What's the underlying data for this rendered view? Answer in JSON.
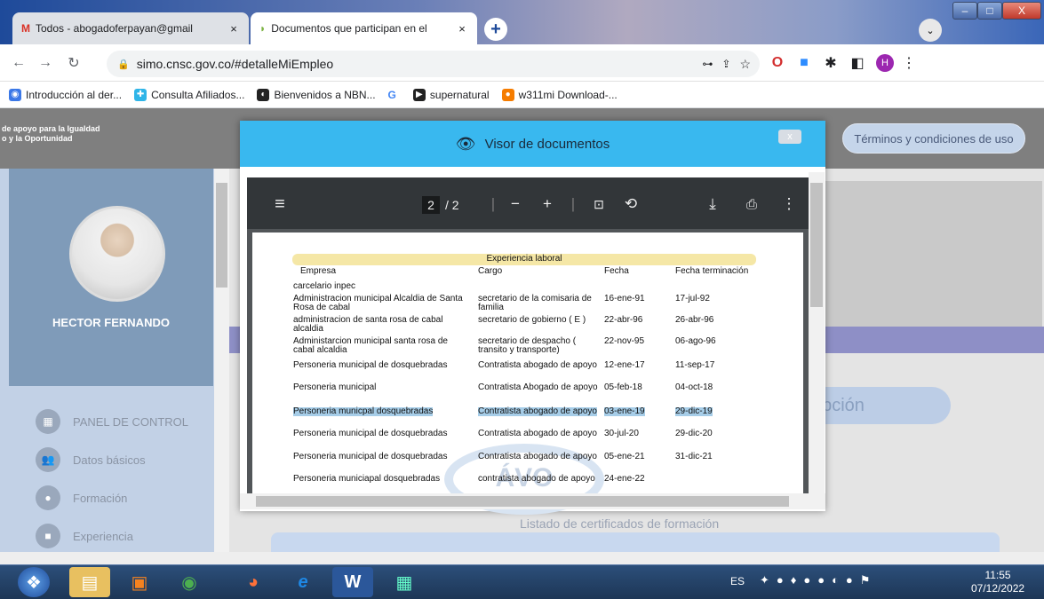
{
  "browser": {
    "tabs": [
      {
        "label": "Todos - abogadoferpayan@gmail",
        "close": "×"
      },
      {
        "label": "Documentos que participan en el",
        "close": "×"
      }
    ],
    "new_tab": "+",
    "url": "simo.cnsc.gov.co/#detalleMiEmpleo",
    "profile_initial": "H",
    "bookmarks": [
      "Introducción al der...",
      "Consulta Afiliados...",
      "Bienvenidos a NBN...",
      "",
      "supernatural",
      "w311mi Download-..."
    ]
  },
  "page": {
    "org_line1": "de apoyo para la Igualdad",
    "org_line2": "o y la Oportunidad",
    "terms_button": "Términos y condiciones de uso",
    "user_name": "HECTOR FERNANDO",
    "nav": [
      "PANEL DE CONTROL",
      "Datos básicos",
      "Formación",
      "Experiencia"
    ],
    "inscription_partial": "ripción",
    "listado": "Listado de certificados de formación"
  },
  "modal": {
    "title": "Visor de documentos",
    "close": "x",
    "viewer": {
      "page_current": "2",
      "page_total": "/ 2"
    },
    "document": {
      "section_title": "Experiencia laboral",
      "columns": [
        "Empresa",
        "Cargo",
        "Fecha",
        "Fecha terminación"
      ],
      "rows": [
        {
          "empresa": "carcelario inpec",
          "cargo": "",
          "fecha": "",
          "fin": ""
        },
        {
          "empresa": "Administracion municipal Alcaldia de Santa",
          "empresa2": "Rosa de cabal",
          "cargo": "secretario de la comisaria de",
          "cargo2": "familia",
          "fecha": "16-ene-91",
          "fin": "17-jul-92"
        },
        {
          "empresa": "administracion de santa rosa de cabal",
          "empresa2": "alcaldia",
          "cargo": "secretario de gobierno ( E )",
          "cargo2": "",
          "fecha": "22-abr-96",
          "fin": "26-abr-96"
        },
        {
          "empresa": "Administarcion municipal santa rosa de",
          "empresa2": "cabal alcaldia",
          "cargo": "secretario de despacho (",
          "cargo2": "transito y transporte)",
          "fecha": "22-nov-95",
          "fin": "06-ago-96"
        },
        {
          "empresa": "Personeria municipal de dosquebradas",
          "cargo": "Contratista abogado de apoyo",
          "fecha": "12-ene-17",
          "fin": "11-sep-17"
        },
        {
          "empresa": "Personeria municipal",
          "cargo": "Contratista Abogado de apoyo",
          "fecha": "05-feb-18",
          "fin": "04-oct-18"
        },
        {
          "empresa": "Personeria municpal dosquebradas",
          "cargo": "Contratista abogado de apoyo",
          "fecha": "03-ene-19",
          "fin": "29-dic-19"
        },
        {
          "empresa": "Personeria municipal de dosquebradas",
          "cargo": "Contratista abogado de apoyo",
          "fecha": "30-jul-20",
          "fin": "29-dic-20"
        },
        {
          "empresa": "Personeria municipal de dosquebradas",
          "cargo": "Contratista abogado de apoyo",
          "fecha": "05-ene-21",
          "fin": "31-dic-21"
        },
        {
          "empresa": "Personeria municiapal dosquebradas",
          "cargo": "contratista abogado de apoyo",
          "fecha": "24-ene-22",
          "fin": ""
        }
      ]
    }
  },
  "taskbar": {
    "lang": "ES",
    "time": "11:55",
    "date": "07/12/2022"
  },
  "colors": {
    "header": "#39b8ef",
    "highlight": "#a6cde8",
    "section": "#f5e7a6"
  }
}
